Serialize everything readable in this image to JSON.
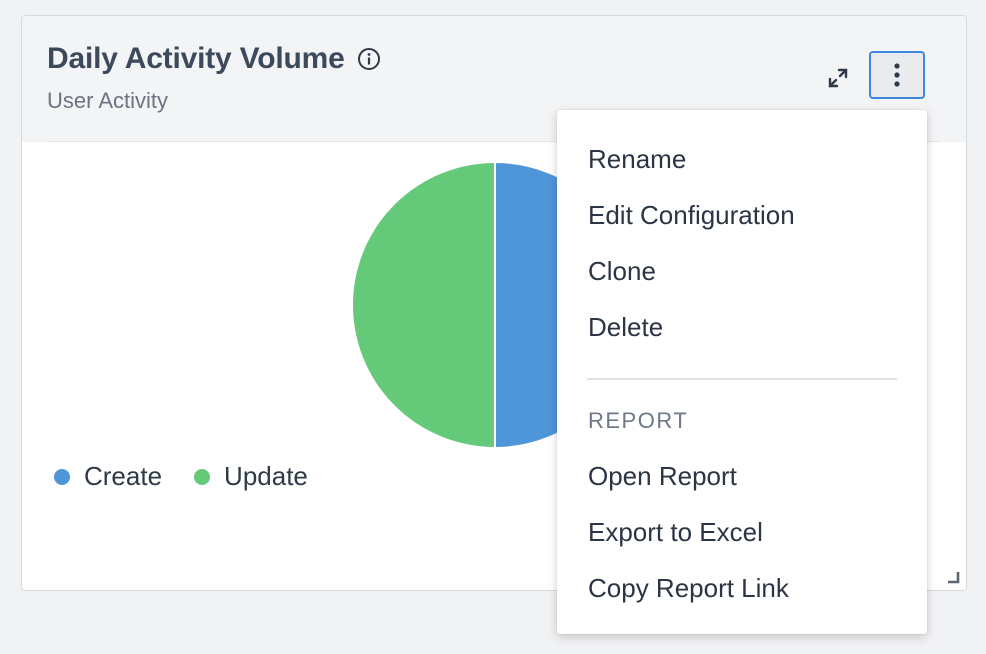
{
  "widget": {
    "title": "Daily Activity Volume",
    "subtitle": "User Activity",
    "icons": {
      "info": "info-icon",
      "expand": "expand-icon",
      "more": "more-vertical-icon",
      "resize": "resize-handle-icon"
    }
  },
  "chart_data": {
    "type": "pie",
    "series": [
      {
        "name": "Create",
        "value": 50,
        "color": "#4f96d9"
      },
      {
        "name": "Update",
        "value": 50,
        "color": "#65c97a"
      }
    ],
    "legend_position": "bottom-left"
  },
  "menu": {
    "items": [
      "Rename",
      "Edit Configuration",
      "Clone",
      "Delete"
    ],
    "section_label": "REPORT",
    "report_items": [
      "Open Report",
      "Export to Excel",
      "Copy Report Link"
    ]
  },
  "colors": {
    "accent": "#3f87de",
    "create": "#4f96d9",
    "update": "#65c97a"
  }
}
